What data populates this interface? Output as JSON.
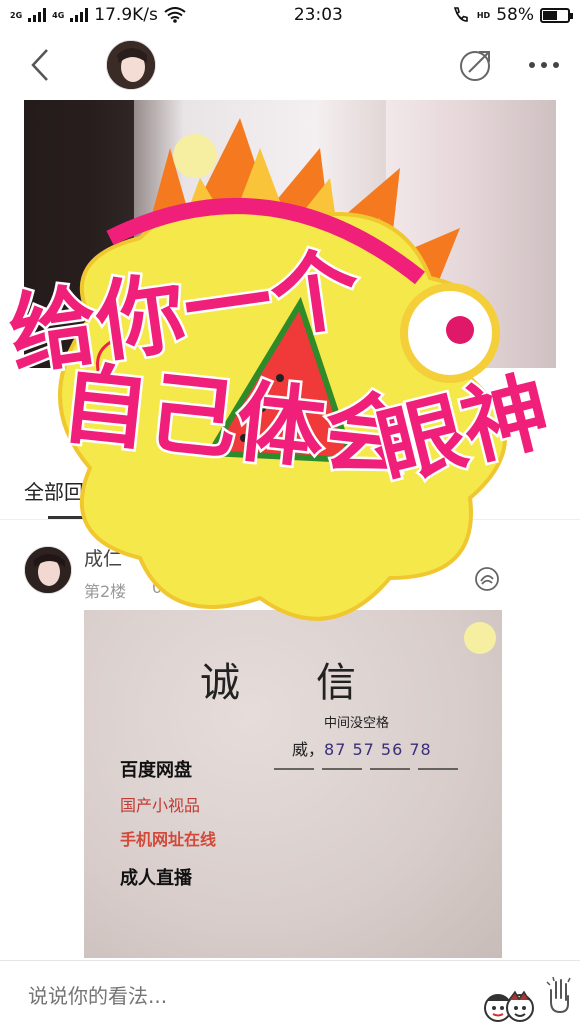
{
  "status_bar": {
    "network_1": "2G",
    "network_2": "4G",
    "speed": "17.9K/s",
    "time": "23:03",
    "hd_label": "HD",
    "battery_text": "58%",
    "battery_level": 0.58
  },
  "nav": {
    "back_icon": "chevron-left-icon",
    "share_icon": "share-icon",
    "more_icon": "more-horizontal-icon"
  },
  "sticker": {
    "line1": "给你一个",
    "line2": "自己体会",
    "line3": "眼神"
  },
  "tabs": {
    "all_label": "全部回"
  },
  "post": {
    "author": "成仁",
    "floor": "第2楼",
    "date": "02-2"
  },
  "post_image": {
    "title": "诚信",
    "note": "中间没空格",
    "contact_prefix": "威，",
    "contact_number": "87 57 56 78",
    "items": [
      "百度网盘",
      "国产小视品",
      "手机网址在线",
      "成人直播"
    ]
  },
  "comment_bar": {
    "placeholder": "说说你的看法..."
  },
  "colors": {
    "sticker_pink": "#f0207a",
    "sticker_yellow": "#f7e64a",
    "accent_purple": "#3a2f7a"
  }
}
